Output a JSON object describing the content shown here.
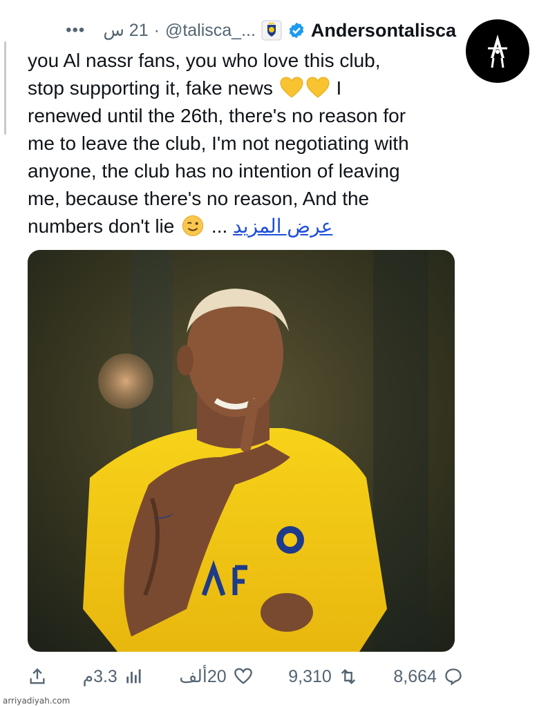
{
  "header": {
    "display_name": "Andersontalisca",
    "handle": "@talisca_...",
    "separator": "·",
    "time": "21 س",
    "more_label": "•••"
  },
  "tweet": {
    "lines": [
      "you Al nassr fans, you who love this club,",
      "stop supporting it, fake news",
      "I",
      "renewed until the 26th, there's no reason for",
      "me to leave the club, I'm not negotiating with",
      "anyone, the club has no intention of leaving",
      "me, because there's no reason, And the",
      "numbers don't lie",
      "..."
    ],
    "see_more": "عرض المزيد"
  },
  "actions": {
    "replies": "8,664",
    "retweets": "9,310",
    "likes": "20ألف",
    "views": "3.3م"
  },
  "icons": {
    "avatar": "logo-icon",
    "verified": "verified-badge-icon",
    "club": "club-badge-icon",
    "reply": "reply-icon",
    "retweet": "retweet-icon",
    "like": "heart-icon",
    "views": "views-icon",
    "share": "share-icon"
  },
  "colors": {
    "accent_link": "#1d4ed8",
    "verified_blue": "#1d9bf0",
    "muted": "#536471",
    "jersey_yellow": "#f4c914"
  },
  "watermark": "arriyadiyah.com"
}
